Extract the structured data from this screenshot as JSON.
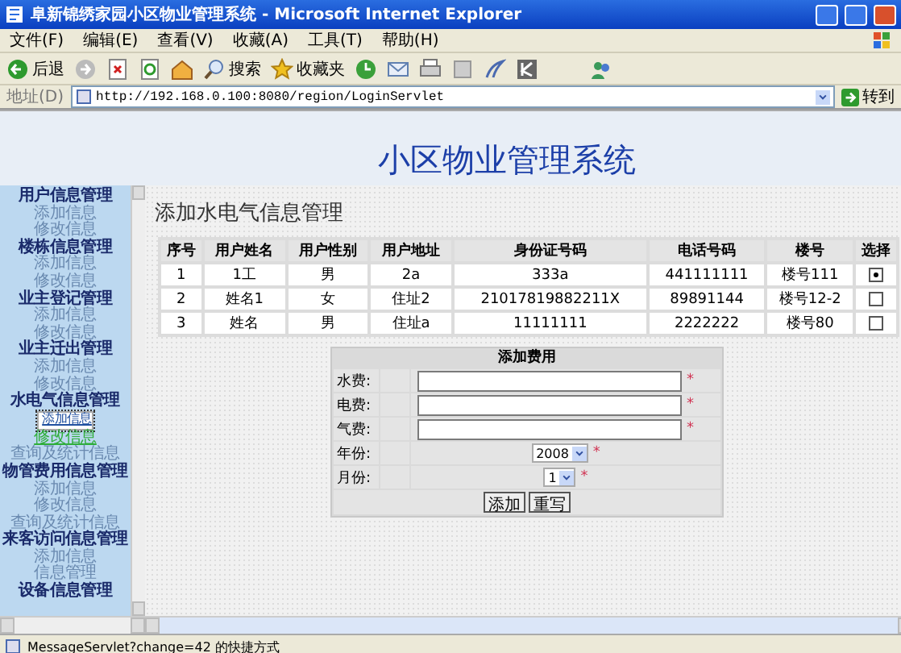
{
  "window": {
    "title": "阜新锦绣家园小区物业管理系统 - Microsoft Internet Explorer"
  },
  "menu": [
    "文件(F)",
    "编辑(E)",
    "查看(V)",
    "收藏(A)",
    "工具(T)",
    "帮助(H)"
  ],
  "toolbar": {
    "back": "后退",
    "search": "搜索",
    "favorites": "收藏夹"
  },
  "address": {
    "label": "地址(D)",
    "url": "http://192.168.0.100:8080/region/LoginServlet",
    "go": "转到"
  },
  "page": {
    "title": "小区物业管理系统",
    "heading": "添加水电气信息管理"
  },
  "sidebar": {
    "groups": [
      {
        "title": "用户信息管理",
        "items": [
          {
            "label": "添加信息",
            "selected": false,
            "hovered": false
          },
          {
            "label": "修改信息",
            "selected": false,
            "hovered": false
          }
        ]
      },
      {
        "title": "楼栋信息管理",
        "items": [
          {
            "label": "添加信息",
            "selected": false,
            "hovered": false
          },
          {
            "label": "修改信息",
            "selected": false,
            "hovered": false
          }
        ]
      },
      {
        "title": "业主登记管理",
        "items": [
          {
            "label": "添加信息",
            "selected": false,
            "hovered": false
          },
          {
            "label": "修改信息",
            "selected": false,
            "hovered": false
          }
        ]
      },
      {
        "title": "业主迁出管理",
        "items": [
          {
            "label": "添加信息",
            "selected": false,
            "hovered": false
          },
          {
            "label": "修改信息",
            "selected": false,
            "hovered": false
          }
        ]
      },
      {
        "title": "水电气信息管理",
        "items": [
          {
            "label": "添加信息",
            "selected": true,
            "hovered": false
          },
          {
            "label": "修改信息",
            "selected": false,
            "hovered": true
          },
          {
            "label": "查询及统计信息",
            "selected": false,
            "hovered": false
          }
        ]
      },
      {
        "title": "物管费用信息管理",
        "items": [
          {
            "label": "添加信息",
            "selected": false,
            "hovered": false
          },
          {
            "label": "修改信息",
            "selected": false,
            "hovered": false
          },
          {
            "label": "查询及统计信息",
            "selected": false,
            "hovered": false
          }
        ]
      },
      {
        "title": "来客访问信息管理",
        "items": [
          {
            "label": "添加信息",
            "selected": false,
            "hovered": false
          },
          {
            "label": "信息管理",
            "selected": false,
            "hovered": false
          }
        ]
      },
      {
        "title": "设备信息管理"
      }
    ]
  },
  "table": {
    "columns": [
      "序号",
      "用户姓名",
      "用户性别",
      "用户地址",
      "身份证号码",
      "电话号码",
      "楼号",
      "选择"
    ],
    "rows": [
      {
        "cells": [
          "1",
          "1工",
          "男",
          "2a",
          "333a",
          "441111111",
          "楼号111"
        ],
        "selected": true
      },
      {
        "cells": [
          "2",
          "姓名1",
          "女",
          "住址2",
          "21017819882211X",
          "89891144",
          "楼号12-2"
        ],
        "selected": false
      },
      {
        "cells": [
          "3",
          "姓名",
          "男",
          "住址a",
          "11111111",
          "2222222",
          "楼号80"
        ],
        "selected": false
      }
    ]
  },
  "form": {
    "title": "添加费用",
    "fields": [
      {
        "kind": "text",
        "label": "水费:",
        "required": "*"
      },
      {
        "kind": "text",
        "label": "电费:",
        "required": "*"
      },
      {
        "kind": "text",
        "label": "气费:",
        "required": "*"
      },
      {
        "kind": "select",
        "label": "年份:",
        "value": "2008",
        "required": "*"
      },
      {
        "kind": "select",
        "label": "月份:",
        "value": "1",
        "required": "*"
      }
    ],
    "buttons": [
      "添加",
      "重写"
    ]
  },
  "status_bar": {
    "text": "MessageServlet?change=42  的快捷方式"
  }
}
